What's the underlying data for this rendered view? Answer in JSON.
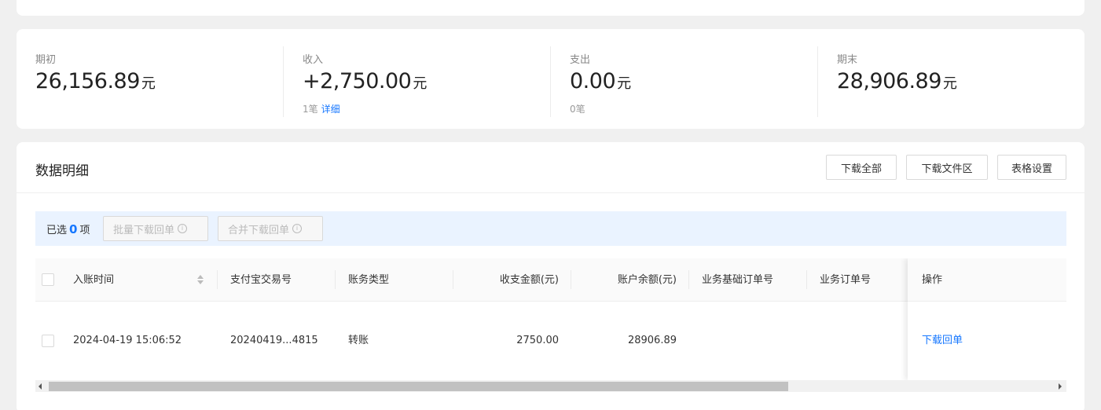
{
  "summary": {
    "opening": {
      "label": "期初",
      "value": "26,156.89",
      "unit": "元"
    },
    "income": {
      "label": "收入",
      "value": "+2,750.00",
      "unit": "元",
      "count": "1笔",
      "link": "详细"
    },
    "expense": {
      "label": "支出",
      "value": "0.00",
      "unit": "元",
      "count": "0笔"
    },
    "closing": {
      "label": "期末",
      "value": "28,906.89",
      "unit": "元"
    }
  },
  "detail": {
    "title": "数据明细",
    "buttons": {
      "download_all": "下载全部",
      "download_files": "下载文件区",
      "table_settings": "表格设置"
    }
  },
  "selection": {
    "prefix": "已选",
    "count": "0",
    "suffix": "项",
    "batch_download": "批量下载回单",
    "merge_download": "合并下载回单",
    "info_glyph": "i"
  },
  "table": {
    "columns": {
      "time": "入账时间",
      "trade_no": "支付宝交易号",
      "type": "账务类型",
      "amount": "收支金额(元)",
      "balance": "账户余额(元)",
      "base_order": "业务基础订单号",
      "order": "业务订单号",
      "action": "操作"
    },
    "rows": [
      {
        "time": "2024-04-19 15:06:52",
        "trade_no": "20240419...4815",
        "type": "转账",
        "amount": "2750.00",
        "balance": "28906.89",
        "base_order": "",
        "order": "",
        "action": "下载回单"
      }
    ]
  },
  "colors": {
    "accent": "#1677ff",
    "selection_bg": "#eaf3ff",
    "page_bg": "#f0f0f0"
  }
}
